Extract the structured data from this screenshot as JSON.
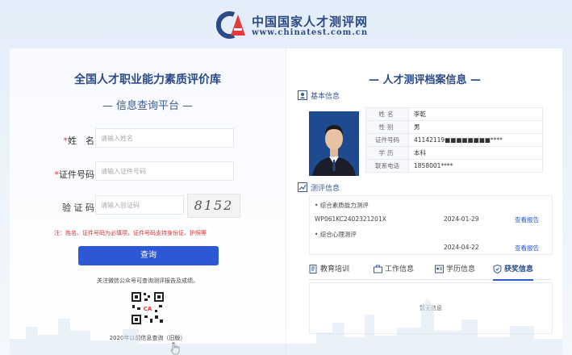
{
  "header": {
    "brand_cn": "中国国家人才测评网",
    "brand_url": "www.chinatest.com.cn",
    "brand_color": "#2b4a86",
    "logo_accent": "#e23b3b"
  },
  "left": {
    "db_title": "全国人才职业能力素质评价库",
    "sub_title": "— 信息查询平台 —",
    "fields": [
      {
        "required": "*",
        "label": "姓　名：",
        "placeholder": "请输入姓名"
      },
      {
        "required": "*",
        "label": "证件号码：",
        "placeholder": "请输入证件号码"
      },
      {
        "required": "",
        "label": "验 证 码：",
        "placeholder": "请输入验证码"
      }
    ],
    "captcha": "8152",
    "note": "注：姓名、证件号码为必填项，证件号码支持身份证、护照等",
    "query_button": "查询",
    "wechat_hint": "关注微信公众号可查询测评报告及成绩。",
    "old_link": "2020年以前信息查询（旧版）",
    "button_color": "#2c58d6"
  },
  "right": {
    "title": "— 人才测评档案信息 —",
    "basic_section": "基本信息",
    "info_rows": [
      {
        "k": "姓名",
        "v": "李乾"
      },
      {
        "k": "性别",
        "v": "男"
      },
      {
        "k": "证件号码",
        "v": "41142119■■■■■■■■****"
      },
      {
        "k": "学历",
        "v": "本科"
      },
      {
        "k": "联系电话",
        "v": "1858001****"
      }
    ],
    "eval_section": "测评信息",
    "evals": [
      {
        "name": "• 综合素质能力测评",
        "code": "WP061KC2402321201X",
        "date": "2024-01-29",
        "action": "查看报告"
      },
      {
        "name": "• 综合心理测评",
        "code": "",
        "date": "2024-04-22",
        "action": "查看报告"
      }
    ],
    "tabs": [
      "教育培训",
      "工作信息",
      "学历信息",
      "获奖信息"
    ],
    "active_tab": 3,
    "empty_text": "暂无信息"
  }
}
